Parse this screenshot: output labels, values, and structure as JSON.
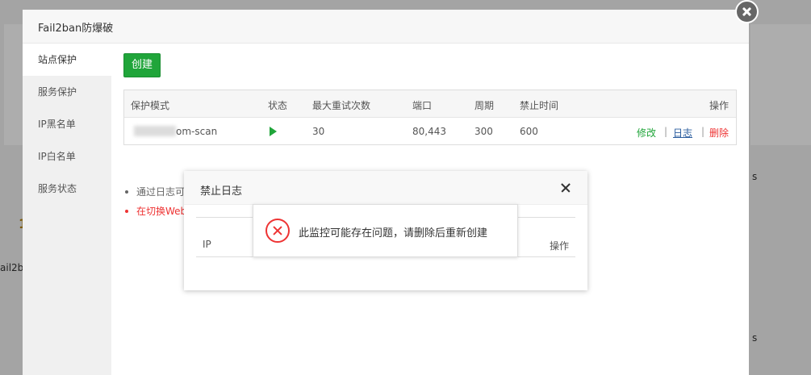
{
  "background": {
    "fragments": [
      "1",
      "ail2ban",
      "s",
      "s"
    ]
  },
  "main_modal": {
    "title": "Fail2ban防爆破",
    "sidebar": {
      "items": [
        {
          "label": "站点保护",
          "active": true
        },
        {
          "label": "服务保护",
          "active": false
        },
        {
          "label": "IP黑名单",
          "active": false
        },
        {
          "label": "IP白名单",
          "active": false
        },
        {
          "label": "服务状态",
          "active": false
        }
      ]
    },
    "create_label": "创建",
    "table": {
      "headers": [
        "保护模式",
        "状态",
        "最大重试次数",
        "端口",
        "周期",
        "禁止时间",
        "操作"
      ],
      "rows": [
        {
          "mode": "om-scan",
          "retries": "30",
          "port": "80,443",
          "period": "300",
          "ban_time": "600",
          "ops": {
            "edit": "修改",
            "sep": "|",
            "log": "日志",
            "del": "删除"
          }
        }
      ]
    },
    "tips": [
      "通过日志可",
      "在切换Web"
    ]
  },
  "sub_modal": {
    "title": "禁止日志",
    "headers": {
      "ip": "IP",
      "op": "操作"
    }
  },
  "toast": {
    "message": "此监控可能存在问题，请删除后重新创建"
  },
  "colors": {
    "accent_green": "#20a53a",
    "danger_red": "#e33333",
    "link_blue": "#2a5c9e"
  }
}
